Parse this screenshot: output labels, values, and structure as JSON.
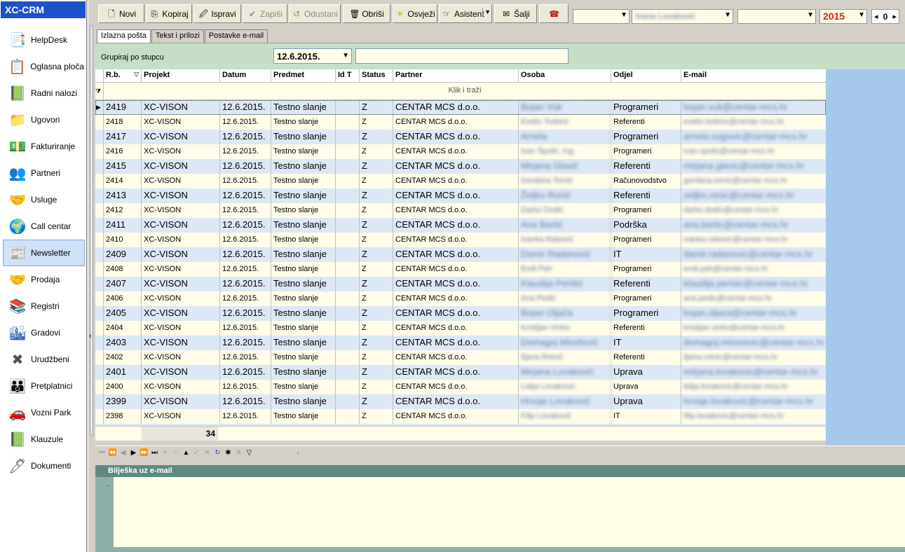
{
  "app": {
    "title": "XC-CRM"
  },
  "sidebar": {
    "items": [
      {
        "label": "HelpDesk",
        "icon": "helpdesk-icon"
      },
      {
        "label": "Oglasna ploča",
        "icon": "bulletin-board-icon"
      },
      {
        "label": "Radni nalozi",
        "icon": "work-orders-icon"
      },
      {
        "label": "Ugovori",
        "icon": "contracts-icon"
      },
      {
        "label": "Fakturiranje",
        "icon": "invoicing-icon"
      },
      {
        "label": "Partneri",
        "icon": "partners-icon"
      },
      {
        "label": "Usluge",
        "icon": "services-icon"
      },
      {
        "label": "Call centar",
        "icon": "call-center-icon"
      },
      {
        "label": "Newsletter",
        "icon": "newsletter-icon",
        "active": true
      },
      {
        "label": "Prodaja",
        "icon": "sales-icon"
      },
      {
        "label": "Registri",
        "icon": "registers-icon"
      },
      {
        "label": "Gradovi",
        "icon": "cities-icon"
      },
      {
        "label": "Urudžbeni",
        "icon": "registry-book-icon"
      },
      {
        "label": "Pretplatnici",
        "icon": "subscribers-icon"
      },
      {
        "label": "Vozni Park",
        "icon": "vehicle-fleet-icon"
      },
      {
        "label": "Klauzule",
        "icon": "clauses-icon"
      },
      {
        "label": "Dokumenti",
        "icon": "documents-icon"
      }
    ]
  },
  "toolbar": {
    "novi": "Novi",
    "kopiraj": "Kopiraj",
    "ispravi": "Ispravi",
    "zapisi": "Zapiši",
    "odustani": "Odustani",
    "obrisi": "Obriši",
    "osvjezi": "Osvježi",
    "asistent": "Asistent",
    "salji": "Šalji",
    "combo1": "",
    "combo2": "Ivana Lovaković",
    "combo3": "",
    "year": "2015",
    "spin_value": "0"
  },
  "tabs": [
    "Izlazna pošta",
    "Tekst i prilozi",
    "Postavke e-mail"
  ],
  "group": {
    "label": "Grupiraj po stupcu",
    "date": "12.6.2015.",
    "filter": ""
  },
  "grid": {
    "columns": [
      "R.b.",
      "Projekt",
      "Datum",
      "Predmet",
      "Id T",
      "Status",
      "Partner",
      "Osoba",
      "Odjel",
      "E-mail"
    ],
    "find_text": "Klik i traži",
    "rows": [
      {
        "rb": "2419",
        "projekt": "XC-VISON",
        "datum": "12.6.2015.",
        "predmet": "Testno slanje",
        "idt": "",
        "status": "Z",
        "partner": "CENTAR MCS d.o.o.",
        "osoba": "Bojan Vuk",
        "odjel": "Programeri",
        "email": "bojan.vuk@centar-mcs.hr"
      },
      {
        "rb": "2418",
        "projekt": "XC-VISON",
        "datum": "12.6.2015.",
        "predmet": "Testno slanje",
        "idt": "",
        "status": "Z",
        "partner": "CENTAR MCS d.o.o.",
        "osoba": "Evelin Todorić",
        "odjel": "Referenti",
        "email": "evelin.todoric@centar-mcs.hr"
      },
      {
        "rb": "2417",
        "projekt": "XC-VISON",
        "datum": "12.6.2015.",
        "predmet": "Testno slanje",
        "idt": "",
        "status": "Z",
        "partner": "CENTAR MCS d.o.o.",
        "osoba": "Arnela",
        "odjel": "Programeri",
        "email": "arnela.sugovic@centar-mcs.hr"
      },
      {
        "rb": "2416",
        "projekt": "XC-VISON",
        "datum": "12.6.2015.",
        "predmet": "Testno slanje",
        "idt": "",
        "status": "Z",
        "partner": "CENTAR MCS d.o.o.",
        "osoba": "Ivan Špolić, ing.",
        "odjel": "Programeri",
        "email": "ivan.spolic@centar-mcs.hr"
      },
      {
        "rb": "2415",
        "projekt": "XC-VISON",
        "datum": "12.6.2015.",
        "predmet": "Testno slanje",
        "idt": "",
        "status": "Z",
        "partner": "CENTAR MCS d.o.o.",
        "osoba": "Mirjana Glavić",
        "odjel": "Referenti",
        "email": "mirjana.glavic@centar-mcs.hr"
      },
      {
        "rb": "2414",
        "projekt": "XC-VISON",
        "datum": "12.6.2015.",
        "predmet": "Testno slanje",
        "idt": "",
        "status": "Z",
        "partner": "CENTAR MCS d.o.o.",
        "osoba": "Gordana Tomić",
        "odjel": "Računovodstvo",
        "email": "gordana.tomic@centar-mcs.hr"
      },
      {
        "rb": "2413",
        "projekt": "XC-VISON",
        "datum": "12.6.2015.",
        "predmet": "Testno slanje",
        "idt": "",
        "status": "Z",
        "partner": "CENTAR MCS d.o.o.",
        "osoba": "Željko Ronić",
        "odjel": "Referenti",
        "email": "zeljko.ronic@centar-mcs.hr"
      },
      {
        "rb": "2412",
        "projekt": "XC-VISON",
        "datum": "12.6.2015.",
        "predmet": "Testno slanje",
        "idt": "",
        "status": "Z",
        "partner": "CENTAR MCS d.o.o.",
        "osoba": "Darko Dodić",
        "odjel": "Programeri",
        "email": "darko.dodic@centar-mcs.hr"
      },
      {
        "rb": "2411",
        "projekt": "XC-VISON",
        "datum": "12.6.2015.",
        "predmet": "Testno slanje",
        "idt": "",
        "status": "Z",
        "partner": "CENTAR MCS d.o.o.",
        "osoba": "Ana Bartić",
        "odjel": "Podrška",
        "email": "ana.bartic@centar-mcs.hr"
      },
      {
        "rb": "2410",
        "projekt": "XC-VISON",
        "datum": "12.6.2015.",
        "predmet": "Testno slanje",
        "idt": "",
        "status": "Z",
        "partner": "CENTAR MCS d.o.o.",
        "osoba": "Ivanka Rabović",
        "odjel": "Programeri",
        "email": "ivanka.rabovic@centar-mcs.hr"
      },
      {
        "rb": "2409",
        "projekt": "XC-VISON",
        "datum": "12.6.2015.",
        "predmet": "Testno slanje",
        "idt": "",
        "status": "Z",
        "partner": "CENTAR MCS d.o.o.",
        "osoba": "Damir Radanović",
        "odjel": "IT",
        "email": "damir.radanovic@centar-mcs.hr"
      },
      {
        "rb": "2408",
        "projekt": "XC-VISON",
        "datum": "12.6.2015.",
        "predmet": "Testno slanje",
        "idt": "",
        "status": "Z",
        "partner": "CENTAR MCS d.o.o.",
        "osoba": "Endi Pah",
        "odjel": "Programeri",
        "email": "endi.pah@centar-mcs.hr"
      },
      {
        "rb": "2407",
        "projekt": "XC-VISON",
        "datum": "12.6.2015.",
        "predmet": "Testno slanje",
        "idt": "",
        "status": "Z",
        "partner": "CENTAR MCS d.o.o.",
        "osoba": "Klaudija Perišić",
        "odjel": "Referenti",
        "email": "klaudija.perisic@centar-mcs.hr"
      },
      {
        "rb": "2406",
        "projekt": "XC-VISON",
        "datum": "12.6.2015.",
        "predmet": "Testno slanje",
        "idt": "",
        "status": "Z",
        "partner": "CENTAR MCS d.o.o.",
        "osoba": "Ana Pedić",
        "odjel": "Programeri",
        "email": "ana.pedic@centar-mcs.hr"
      },
      {
        "rb": "2405",
        "projekt": "XC-VISON",
        "datum": "12.6.2015.",
        "predmet": "Testno slanje",
        "idt": "",
        "status": "Z",
        "partner": "CENTAR MCS d.o.o.",
        "osoba": "Bojan Oljača",
        "odjel": "Programeri",
        "email": "bojan.oljaca@centar-mcs.hr"
      },
      {
        "rb": "2404",
        "projekt": "XC-VISON",
        "datum": "12.6.2015.",
        "predmet": "Testno slanje",
        "idt": "",
        "status": "Z",
        "partner": "CENTAR MCS d.o.o.",
        "osoba": "Kristijan Vinko",
        "odjel": "Referenti",
        "email": "kristijan.vinko@centar-mcs.hr"
      },
      {
        "rb": "2403",
        "projekt": "XC-VISON",
        "datum": "12.6.2015.",
        "predmet": "Testno slanje",
        "idt": "",
        "status": "Z",
        "partner": "CENTAR MCS d.o.o.",
        "osoba": "Domagoj Mirošević",
        "odjel": "IT",
        "email": "domagoj.mirosevic@centar-mcs.hr"
      },
      {
        "rb": "2402",
        "projekt": "XC-VISON",
        "datum": "12.6.2015.",
        "predmet": "Testno slanje",
        "idt": "",
        "status": "Z",
        "partner": "CENTAR MCS d.o.o.",
        "osoba": "Iljana Rotnić",
        "odjel": "Referenti",
        "email": "iljana.rotnic@centar-mcs.hr"
      },
      {
        "rb": "2401",
        "projekt": "XC-VISON",
        "datum": "12.6.2015.",
        "predmet": "Testno slanje",
        "idt": "",
        "status": "Z",
        "partner": "CENTAR MCS d.o.o.",
        "osoba": "Mirjana Lovaković",
        "odjel": "Uprava",
        "email": "mirjana.lovakovic@centar-mcs.hr"
      },
      {
        "rb": "2400",
        "projekt": "XC-VISON",
        "datum": "12.6.2015.",
        "predmet": "Testno slanje",
        "idt": "",
        "status": "Z",
        "partner": "CENTAR MCS d.o.o.",
        "osoba": "Lidija Lovaković",
        "odjel": "Uprava",
        "email": "lidija.lovakovic@centar-mcs.hr"
      },
      {
        "rb": "2399",
        "projekt": "XC-VISON",
        "datum": "12.6.2015.",
        "predmet": "Testno slanje",
        "idt": "",
        "status": "Z",
        "partner": "CENTAR MCS d.o.o.",
        "osoba": "Hrvoje Lovaković",
        "odjel": "Uprava",
        "email": "hrvoje.lovakovic@centar-mcs.hr"
      },
      {
        "rb": "2398",
        "projekt": "XC-VISON",
        "datum": "12.6.2015.",
        "predmet": "Testno slanje",
        "idt": "",
        "status": "Z",
        "partner": "CENTAR MCS d.o.o.",
        "osoba": "Filip Lovaković",
        "odjel": "IT",
        "email": "filip.lovakovic@centar-mcs.hr"
      }
    ],
    "footer_count": "34"
  },
  "note": {
    "title": "Bilješka uz e-mail",
    "text": ""
  },
  "colors": {
    "sidebar_title": "#1c52c9",
    "row_even": "#dce8f5",
    "row_odd": "#fffce8",
    "group_bar": "#c6dec6",
    "year": "#e0201c",
    "note_title": "#5e8a82"
  }
}
